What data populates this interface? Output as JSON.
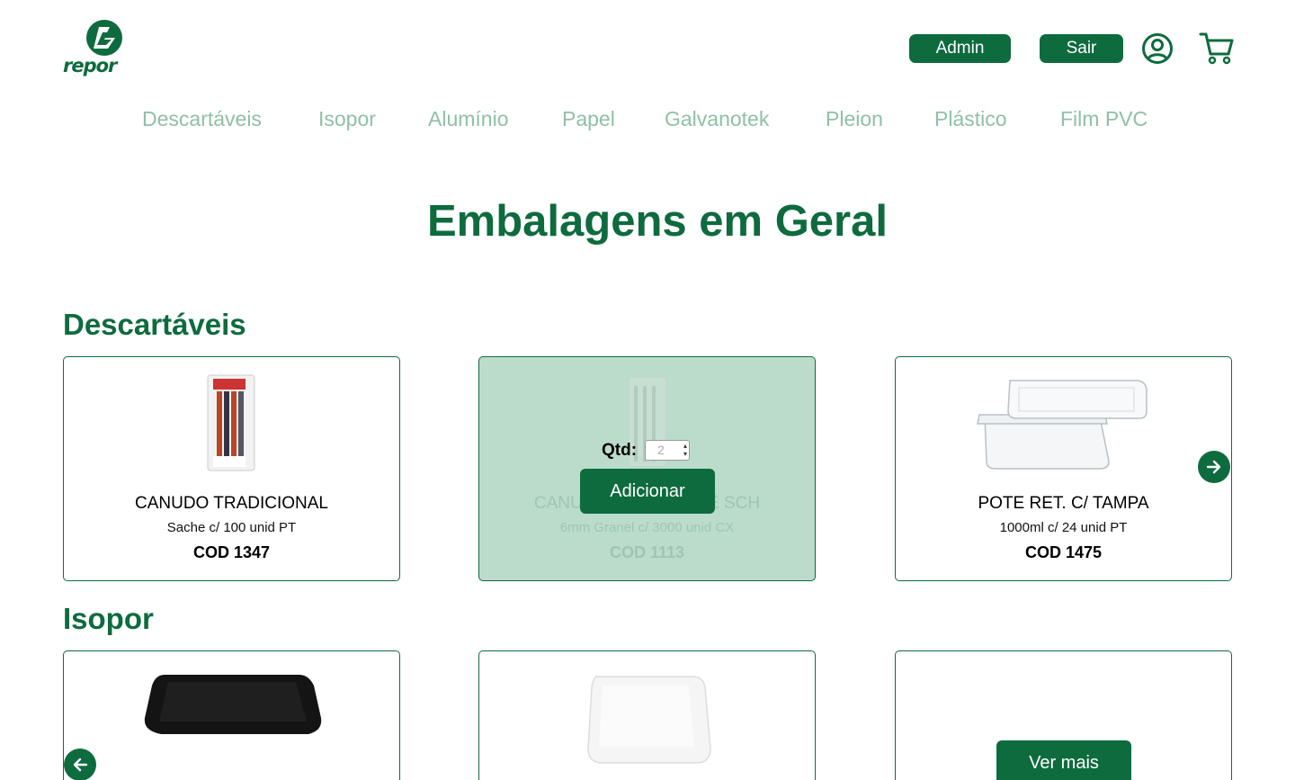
{
  "header": {
    "logo_text": "repor",
    "admin_label": "Admin",
    "logout_label": "Sair",
    "user_icon": "user-circle-icon",
    "cart_icon": "shopping-cart-icon"
  },
  "nav": {
    "items": [
      "Descartáveis",
      "Isopor",
      "Alumínio",
      "Papel",
      "Galvanotek",
      "Pleion",
      "Plástico",
      "Film PVC"
    ]
  },
  "page_title": "Embalagens em Geral",
  "sections": [
    {
      "title": "Descartáveis",
      "products": [
        {
          "name": "CANUDO TRADICIONAL",
          "desc": "Sache c/ 100 unid PT",
          "code": "COD 1347"
        },
        {
          "name": "CANUDO FLEX SACHÊ SCH",
          "desc": "6mm Granel c/ 3000 unid CX",
          "code": "COD 1113",
          "hover": {
            "qty_label": "Qtd:",
            "qty_value": "2",
            "add_label": "Adicionar"
          }
        },
        {
          "name": "POTE RET. C/ TAMPA",
          "desc": "1000ml c/ 24 unid PT",
          "code": "COD 1475"
        }
      ]
    },
    {
      "title": "Isopor",
      "more_label": "Ver mais"
    }
  ],
  "colors": {
    "primary": "#0e6b3e",
    "nav_text": "#8fc0a6",
    "hover_overlay": "#bcdccb"
  }
}
